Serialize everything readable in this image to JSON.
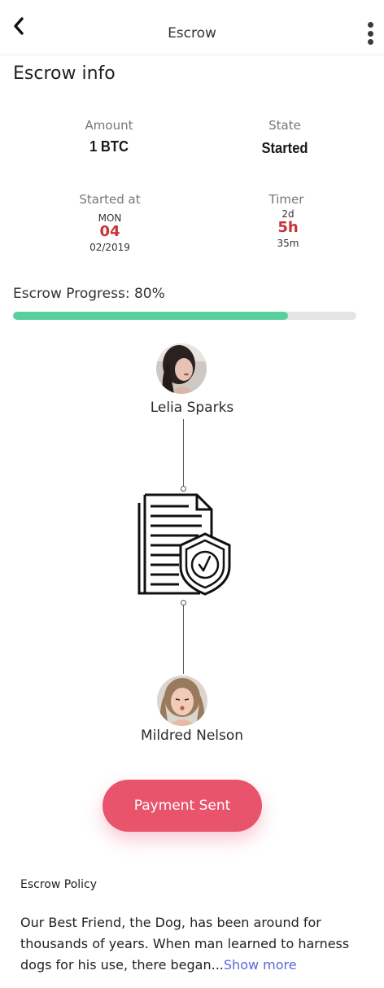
{
  "header": {
    "title": "Escrow"
  },
  "section": {
    "title": "Escrow info"
  },
  "info": {
    "amount_label": "Amount",
    "amount_value": "1 BTC",
    "state_label": "State",
    "state_value": "Started",
    "started_label": "Started at",
    "started_dow": "MON",
    "started_day": "04",
    "started_month_year": "02/2019",
    "timer_label": "Timer",
    "timer_days": "2d",
    "timer_hours": "5h",
    "timer_minutes": "35m"
  },
  "progress": {
    "label": "Escrow Progress: 80%",
    "percent": 80,
    "color": "#58cf9c"
  },
  "parties": [
    {
      "name": "Lelia Sparks"
    },
    {
      "name": "Mildred Nelson"
    }
  ],
  "actions": {
    "payment_sent": "Payment Sent",
    "button_color": "#e8546c"
  },
  "policy": {
    "title": "Escrow Policy",
    "text": "Our Best Friend, the Dog, has been around for thousands of years. When man learned to harness dogs for his use, there began...",
    "show_more": "Show more"
  },
  "icons": {
    "back": "chevron-left-icon",
    "more": "more-vertical-icon",
    "contract": "document-shield-check-icon"
  }
}
